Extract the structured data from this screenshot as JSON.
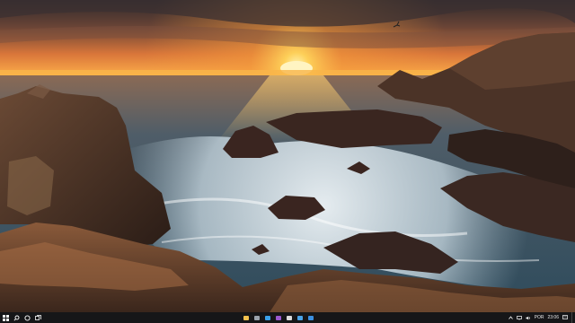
{
  "wallpaper": {
    "scene": "sunset-over-rocky-coast-icon",
    "sky_top": "#3a2e2e",
    "sun_color": "#ffc24a",
    "sea_color": "#3d5a6b",
    "foam_color": "#dfe8ee",
    "rock_color": "#4a3226"
  },
  "taskbar": {
    "background": "#161618",
    "start_icon": "windows-logo-icon",
    "search_icon": "search-icon",
    "cortana_icon": "cortana-circle-icon",
    "task_view_icon": "task-view-icon",
    "pinned_apps": [
      {
        "name": "file-explorer-icon",
        "color": "#f2c14e"
      },
      {
        "name": "app-icon",
        "color": "#9aa3ad"
      },
      {
        "name": "check-icon",
        "color": "#3aa0e8"
      },
      {
        "name": "visual-studio-icon",
        "color": "#9b59d0"
      },
      {
        "name": "store-icon",
        "color": "#dcdcdc"
      },
      {
        "name": "mail-icon",
        "color": "#4aa3e8"
      },
      {
        "name": "edge-icon",
        "color": "#3b8fe0"
      }
    ],
    "tray": {
      "chevron_icon": "chevron-up-icon",
      "network_icon": "network-icon",
      "volume_icon": "volume-icon",
      "language": "POR",
      "time": "23:06",
      "notification_icon": "notification-icon"
    }
  }
}
